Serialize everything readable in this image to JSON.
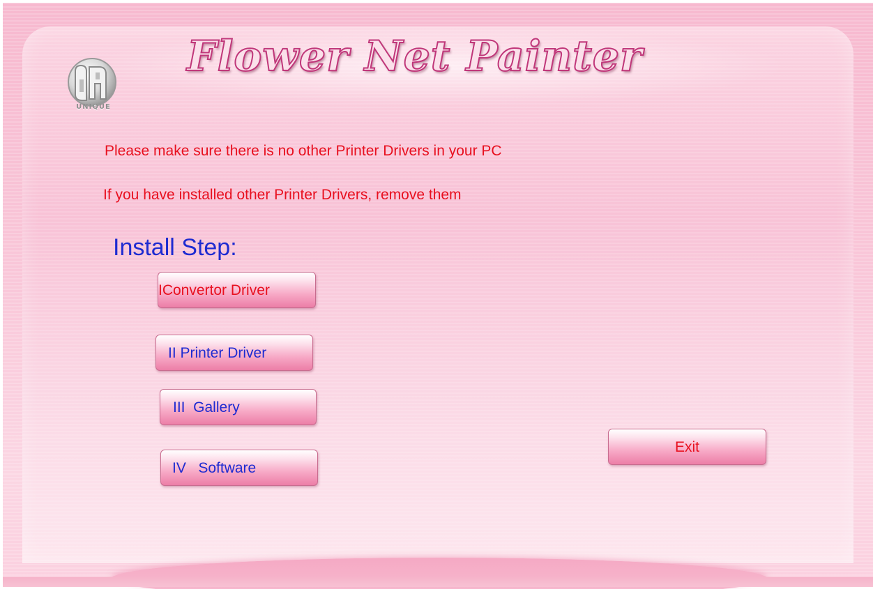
{
  "app": {
    "title": "Flower Net Painter",
    "logo_text": "UNIQUE"
  },
  "notices": {
    "line1": "Please make sure there is no other Printer Drivers in your PC",
    "line2": "If you have installed other Printer Drivers, remove them"
  },
  "install": {
    "heading": "Install Step:",
    "steps": [
      {
        "label": "IConvertor Driver"
      },
      {
        "label": "II Printer Driver"
      },
      {
        "label": "III  Gallery"
      },
      {
        "label": "IV   Software"
      }
    ]
  },
  "actions": {
    "exit_label": "Exit"
  },
  "colors": {
    "warning_red": "#e8101f",
    "label_blue": "#1e2bd1",
    "background_pink": "#f9c6d8",
    "title_outline": "#c0377a"
  }
}
